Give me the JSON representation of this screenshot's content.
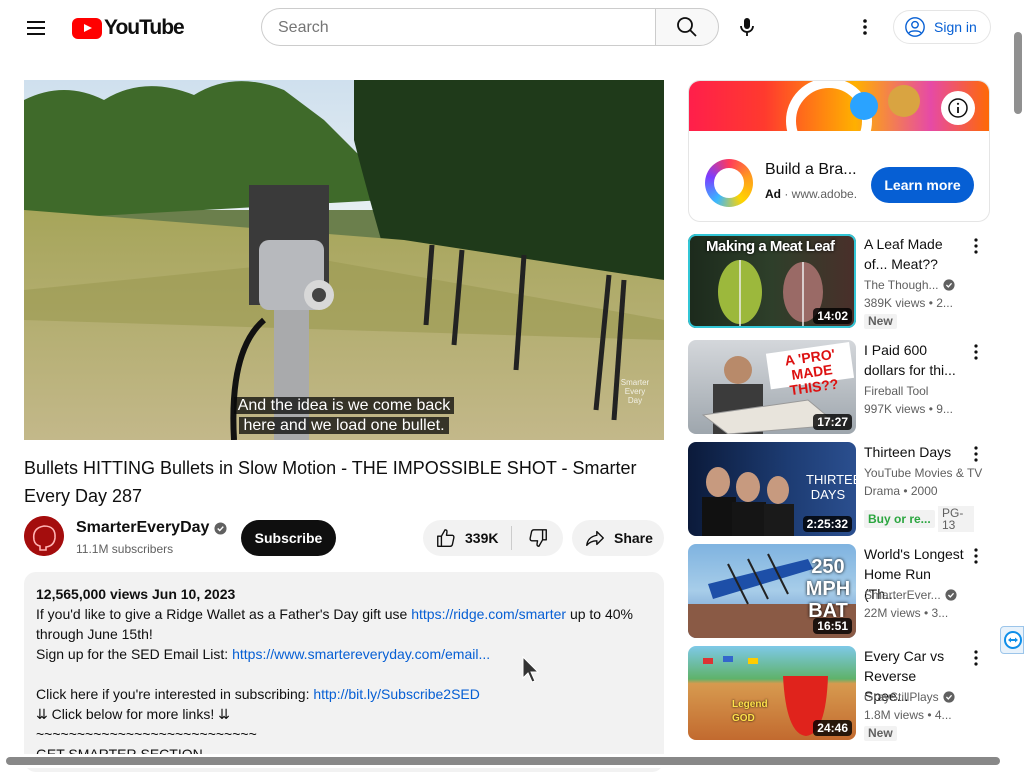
{
  "header": {
    "logo_text": "YouTube",
    "search_placeholder": "Search",
    "signin_label": "Sign in"
  },
  "video": {
    "caption_line1": "And the idea is we come back",
    "caption_line2": "here and we load one bullet.",
    "watermark": "Smarter Every Day",
    "title": "Bullets HITTING Bullets in Slow Motion - THE IMPOSSIBLE SHOT - Smarter Every Day 287"
  },
  "channel": {
    "name": "SmarterEveryDay",
    "subscribers": "11.1M subscribers",
    "subscribe_label": "Subscribe"
  },
  "actions": {
    "likes": "339K",
    "share_label": "Share"
  },
  "description": {
    "views_date": "12,565,000 views  Jun 10, 2023",
    "line1_prefix": "If you'd like to give a Ridge Wallet as a Father's Day gift use ",
    "line1_link": "https://ridge.com/smarter",
    "line1_suffix": " up to 40% through June 15th!",
    "line2_prefix": "Sign up for the SED Email List: ",
    "line2_link": "https://www.smartereveryday.com/email...",
    "line3_prefix": "Click here if you're interested in subscribing: ",
    "line3_link": "http://bit.ly/Subscribe2SED",
    "line4": "⇊  Click below for more links!  ⇊",
    "line5": "~~~~~~~~~~~~~~~~~~~~~~~~~~~",
    "line6": "GET SMARTER SECTION"
  },
  "ad": {
    "title": "Build a Bra...",
    "ad_label": "Ad",
    "domain": "www.adobe.",
    "cta": "Learn more"
  },
  "recommendations": [
    {
      "thumb_text": "Making a Meat Leaf",
      "duration": "14:02",
      "title": "A Leaf Made of... Meat??",
      "channel": "The Though...",
      "verified": true,
      "meta": "389K views  • 2...",
      "badge": "New"
    },
    {
      "thumb_text": "A 'PRO' MADE THIS??",
      "duration": "17:27",
      "title": "I Paid 600 dollars for thi...",
      "channel": "Fireball Tool",
      "verified": false,
      "meta": "997K views  • 9..."
    },
    {
      "thumb_text": "THIRTEEN DAYS",
      "duration": "2:25:32",
      "title": "Thirteen Days",
      "channel": "YouTube Movies & TV",
      "meta": "Drama • 2000",
      "buy": "Buy or re...",
      "rating": "PG-13"
    },
    {
      "thumb_text": "250 MPH BAT",
      "duration": "16:51",
      "title": "World's Longest Home Run (Th...",
      "channel": "SmarterEver...",
      "verified": true,
      "meta": "22M views  • 3..."
    },
    {
      "thumb_text": "Legend GOD",
      "duration": "24:46",
      "title": "Every Car vs Reverse Spee...",
      "channel": "GrayStillPlays",
      "verified": true,
      "meta": "1.8M views  • 4...",
      "badge": "New"
    }
  ]
}
